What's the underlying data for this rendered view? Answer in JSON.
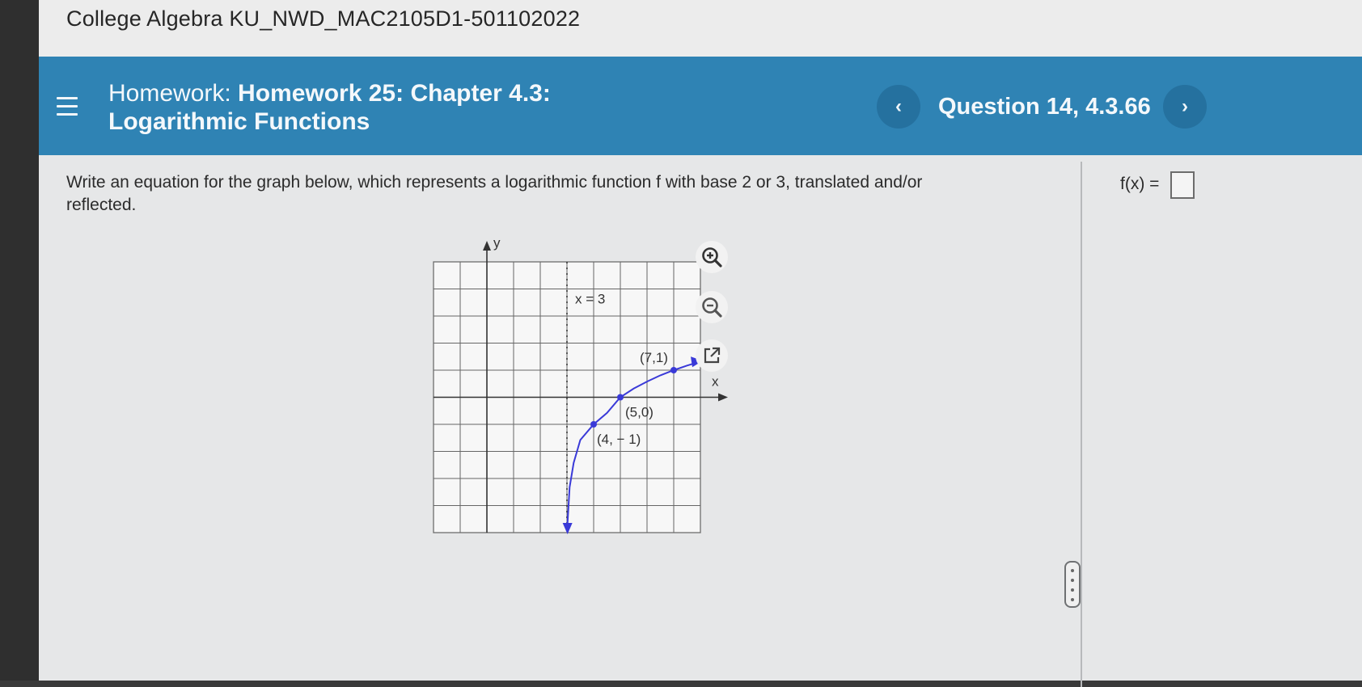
{
  "course": {
    "title": "College Algebra KU_NWD_MAC2105D1-501102022"
  },
  "header": {
    "title_prefix": "Homework: ",
    "title_main": "Homework 25: Chapter 4.3: Logarithmic Functions",
    "question_label": "Question 14, 4.3.66",
    "prev_label": "‹",
    "next_label": "›"
  },
  "question": {
    "text": "Write an equation for the graph below, which represents a logarithmic function f with base 2 or 3, translated and/or reflected.",
    "answer_label": "f(x) =",
    "answer_value": ""
  },
  "graph": {
    "y_axis_label": "y",
    "x_axis_label": "x",
    "asymptote_label": "x = 3",
    "points": [
      {
        "label": "(7,1)",
        "x": 7,
        "y": 1
      },
      {
        "label": "(5,0)",
        "x": 5,
        "y": 0
      },
      {
        "label": "(4, − 1)",
        "x": 4,
        "y": -1
      }
    ]
  },
  "chart_data": {
    "type": "line",
    "title": "",
    "xlabel": "x",
    "ylabel": "y",
    "xlim": [
      -2,
      8
    ],
    "ylim": [
      -5,
      5
    ],
    "grid": true,
    "annotations": [
      "x = 3",
      "(7,1)",
      "(5,0)",
      "(4, − 1)"
    ],
    "series": [
      {
        "x": [
          3.02,
          3.1,
          3.25,
          3.5,
          4,
          4.5,
          5,
          5.5,
          6,
          6.5,
          7,
          7.5,
          8
        ],
        "y": [
          -4.64,
          -3.32,
          -2.42,
          -1.58,
          -1,
          -0.58,
          0,
          0.32,
          0.58,
          0.81,
          1,
          1.17,
          1.32
        ],
        "color": "#3a3ad8"
      }
    ],
    "asymptote": {
      "x": 3
    }
  },
  "tools": {
    "zoom_in_icon": "zoom-in-icon",
    "zoom_out_icon": "zoom-out-icon",
    "popout_icon": "external-link-icon"
  }
}
